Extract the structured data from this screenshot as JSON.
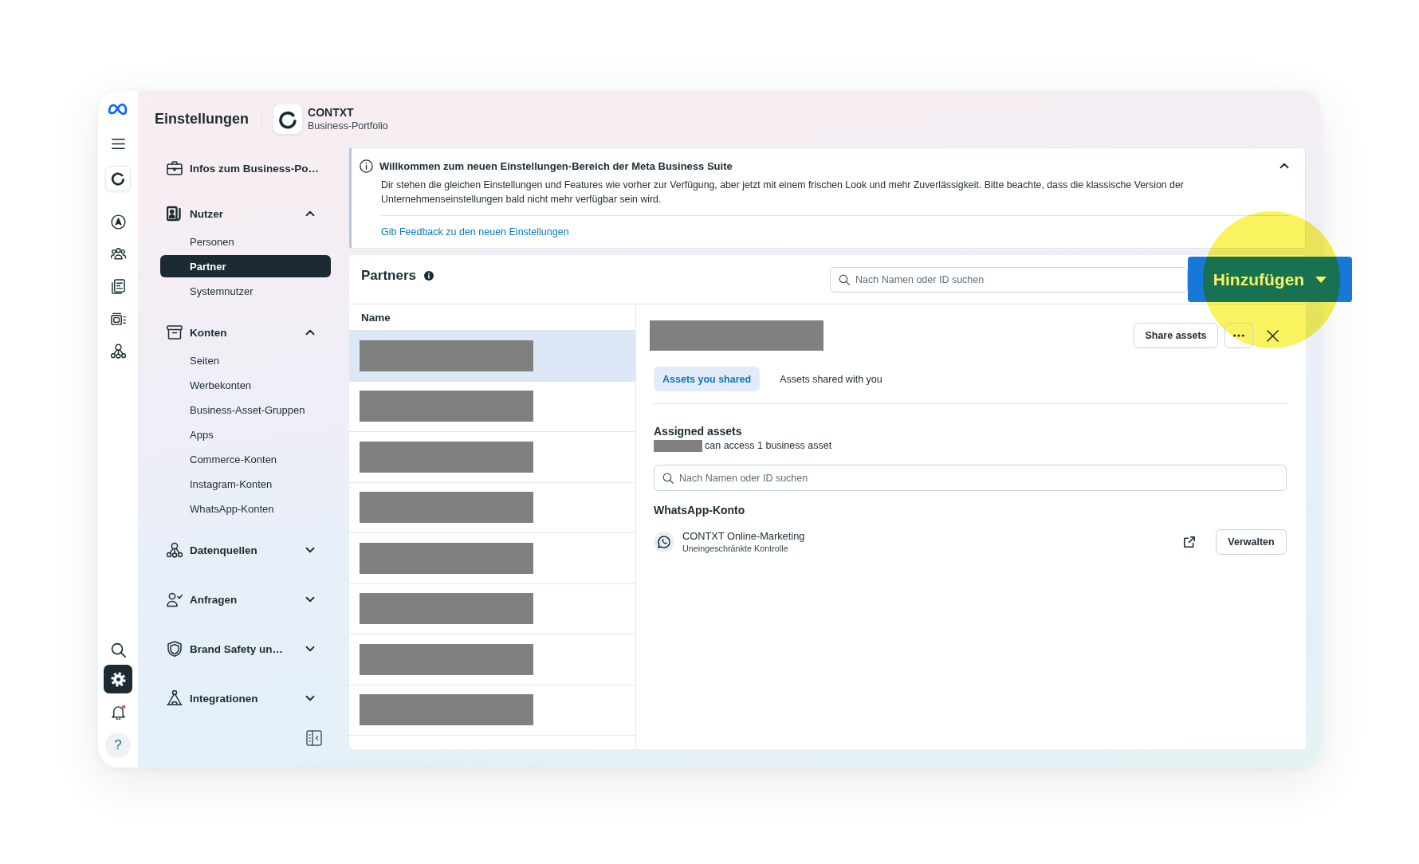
{
  "rail": {
    "top_items": [
      {
        "selected": false
      },
      {
        "selected": false
      },
      {
        "selected": false
      },
      {
        "selected": false
      },
      {
        "selected": false
      },
      {
        "selected": false
      },
      {
        "selected": false
      }
    ],
    "bottom_items": [
      {
        "selected": false,
        "unread": false
      },
      {
        "selected": true,
        "unread": false
      },
      {
        "selected": false,
        "unread": true
      }
    ],
    "help_label": "?"
  },
  "header": {
    "title": "Einstellungen",
    "portfolio_name": "CONTXT",
    "portfolio_type": "Business-Portfolio"
  },
  "sidebar": {
    "overview": {
      "label": "Infos zum Business-Po…"
    },
    "sections": [
      {
        "label": "Nutzer",
        "expanded": true,
        "children": [
          {
            "label": "Personen",
            "selected": false
          },
          {
            "label": "Partner",
            "selected": true
          },
          {
            "label": "Systemnutzer",
            "selected": false
          }
        ]
      },
      {
        "label": "Konten",
        "expanded": true,
        "children": [
          {
            "label": "Seiten",
            "selected": false
          },
          {
            "label": "Werbekonten",
            "selected": false
          },
          {
            "label": "Business-Asset-Gruppen",
            "selected": false
          },
          {
            "label": "Apps",
            "selected": false
          },
          {
            "label": "Commerce-Konten",
            "selected": false
          },
          {
            "label": "Instagram-Konten",
            "selected": false
          },
          {
            "label": "WhatsApp-Konten",
            "selected": false
          }
        ]
      },
      {
        "label": "Datenquellen",
        "expanded": false
      },
      {
        "label": "Anfragen",
        "expanded": false
      },
      {
        "label": "Brand Safety un…",
        "expanded": false
      },
      {
        "label": "Integrationen",
        "expanded": false
      }
    ]
  },
  "banner": {
    "title": "Willkommen zum neuen Einstellungen-Bereich der Meta Business Suite",
    "text": "Dir stehen die gleichen Einstellungen und Features wie vorher zur Verfügung, aber jetzt mit einem frischen Look und mehr Zuverlässigkeit. Bitte beachte, dass die klassische Version der Unternehmenseinstellungen bald nicht mehr verfügbar sein wird.",
    "link": "Gib Feedback zu den neuen Einstellungen",
    "expanded": true
  },
  "partners": {
    "title": "Partners",
    "search_placeholder": "Nach Namen oder ID suchen",
    "add_button": {
      "label": "Hinzufügen",
      "highlighted": true
    },
    "columns": [
      "Name"
    ],
    "rows": [
      {
        "selected": true
      },
      {
        "selected": false
      },
      {
        "selected": false
      },
      {
        "selected": false
      },
      {
        "selected": false
      },
      {
        "selected": false
      },
      {
        "selected": false
      },
      {
        "selected": false
      }
    ]
  },
  "detail": {
    "share_button": "Share assets",
    "tabs": [
      {
        "label": "Assets you shared",
        "selected": true
      },
      {
        "label": "Assets shared with you",
        "selected": false
      }
    ],
    "assigned_title": "Assigned assets",
    "access_text": "can access 1 business asset",
    "search_placeholder": "Nach Namen oder ID suchen",
    "groups": [
      {
        "title": "WhatsApp-Konto",
        "assets": [
          {
            "name": "CONTXT Online-Marketing",
            "access": "Uneingeschränkte Kontrolle",
            "action": "Verwalten"
          }
        ]
      }
    ]
  }
}
